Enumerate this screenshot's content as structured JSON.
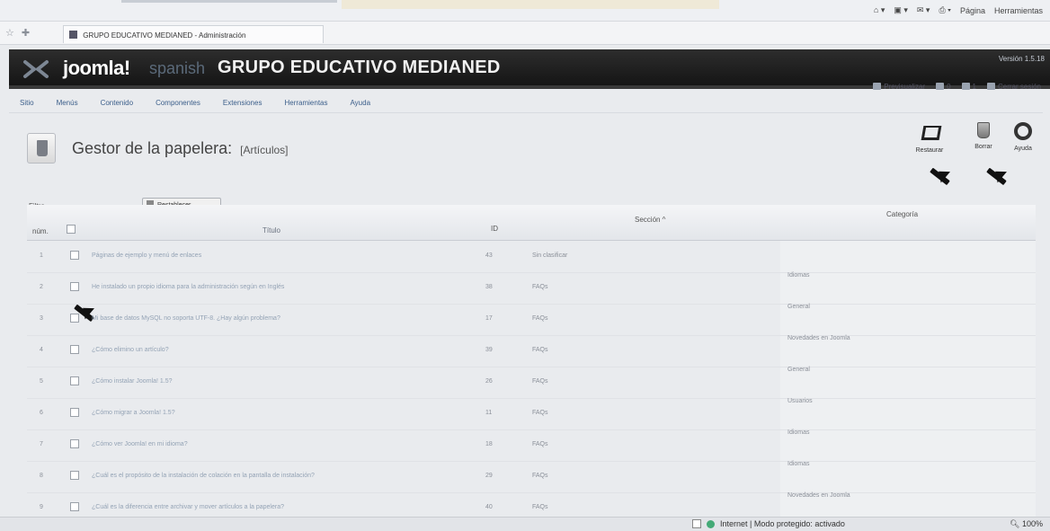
{
  "browser": {
    "tab_title": "GRUPO EDUCATIVO MEDIANED - Administración",
    "tools": [
      "Página",
      "Herramientas"
    ],
    "status_zone": "Internet | Modo protegido: activado",
    "zoom": "100%"
  },
  "header": {
    "logo": "joomla!",
    "logo_sub": "spanish",
    "site_title": "GRUPO EDUCATIVO MEDIANED",
    "version": "Versión 1.5.18"
  },
  "status": {
    "preview": "Previsualizar",
    "messages": "0",
    "users": "1",
    "logout": "Cerrar sesión"
  },
  "menu": [
    "Sitio",
    "Menús",
    "Contenido",
    "Componentes",
    "Extensiones",
    "Herramientas",
    "Ayuda"
  ],
  "page": {
    "title": "Gestor de la papelera:",
    "subtitle": "[Artículos]"
  },
  "toolbar": {
    "restore": "Restaurar",
    "delete": "Borrar",
    "help": "Ayuda"
  },
  "filter": {
    "label": "Filtro",
    "reset": "Restablecer"
  },
  "table": {
    "headers": {
      "num": "núm.",
      "title": "Título",
      "id": "ID",
      "section": "Sección ^",
      "category": "Categoría"
    },
    "rows": [
      {
        "num": "1",
        "title": "Páginas de ejemplo y menú de enlaces",
        "id": "43",
        "section": "Sin clasificar",
        "category": ""
      },
      {
        "num": "2",
        "title": "He instalado un propio idioma para la administración según en Inglés",
        "id": "38",
        "section": "FAQs",
        "category": "Idiomas"
      },
      {
        "num": "3",
        "title": "Mi base de datos MySQL no soporta UTF-8. ¿Hay algún problema?",
        "id": "17",
        "section": "FAQs",
        "category": "General"
      },
      {
        "num": "4",
        "title": "¿Cómo elimino un artículo?",
        "id": "39",
        "section": "FAQs",
        "category": "Novedades en Joomla"
      },
      {
        "num": "5",
        "title": "¿Cómo instalar Joomla! 1.5?",
        "id": "26",
        "section": "FAQs",
        "category": "General"
      },
      {
        "num": "6",
        "title": "¿Cómo migrar a Joomla! 1.5?",
        "id": "11",
        "section": "FAQs",
        "category": "Usuarios"
      },
      {
        "num": "7",
        "title": "¿Cómo ver Joomla! en mi idioma?",
        "id": "18",
        "section": "FAQs",
        "category": "Idiomas"
      },
      {
        "num": "8",
        "title": "¿Cuál es el propósito de la instalación de colación en la pantalla de instalación?",
        "id": "29",
        "section": "FAQs",
        "category": "Idiomas"
      },
      {
        "num": "9",
        "title": "¿Cuál es la diferencia entre archivar y mover artículos a la papelera?",
        "id": "40",
        "section": "FAQs",
        "category": "Novedades en Joomla"
      }
    ]
  }
}
